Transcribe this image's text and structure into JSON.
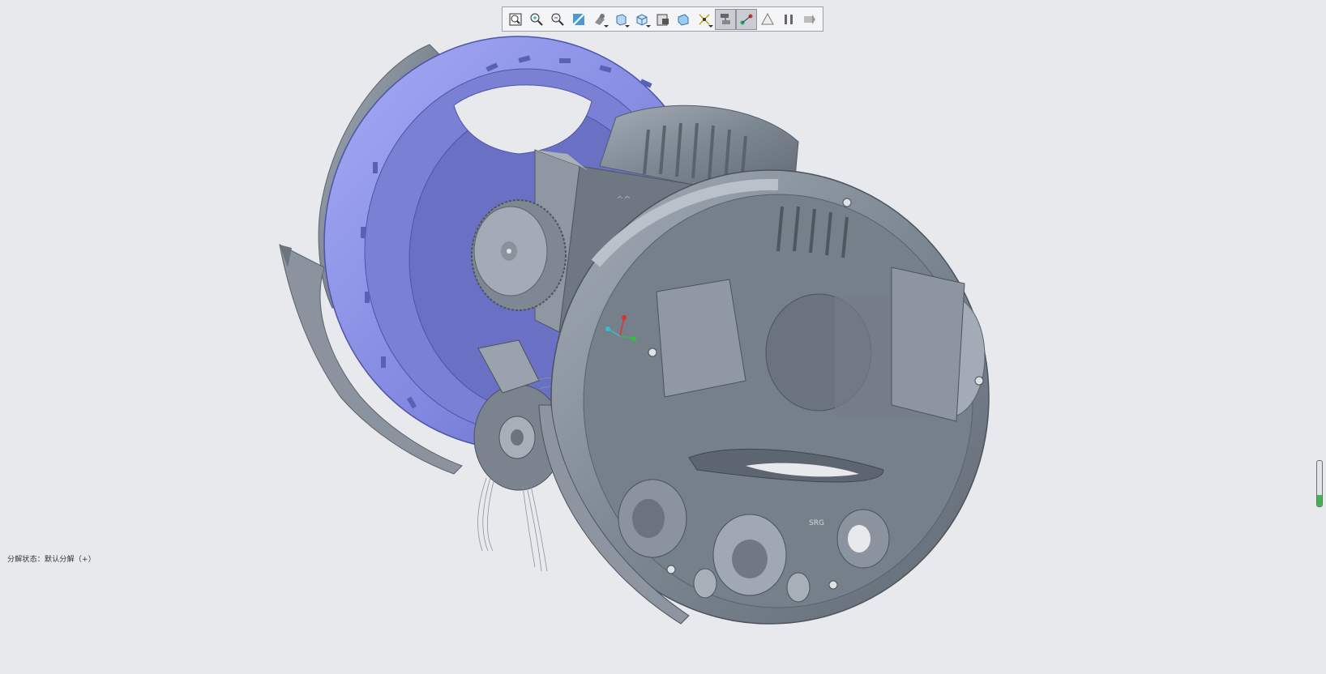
{
  "toolbar": {
    "buttons": [
      {
        "name": "zoom-fit-icon",
        "active": false
      },
      {
        "name": "zoom-in-icon",
        "active": false
      },
      {
        "name": "zoom-out-icon",
        "active": false
      },
      {
        "name": "repaint-icon",
        "active": false
      },
      {
        "name": "view-orientation-icon",
        "active": false,
        "menu": true
      },
      {
        "name": "display-style-icon",
        "active": false,
        "menu": true
      },
      {
        "name": "saved-views-icon",
        "active": false,
        "menu": true
      },
      {
        "name": "view-manager-icon",
        "active": false
      },
      {
        "name": "perspective-icon",
        "active": false
      },
      {
        "name": "datum-display-icon",
        "active": false,
        "menu": true
      },
      {
        "name": "explode-view-icon",
        "active": true
      },
      {
        "name": "edit-position-icon",
        "active": true
      },
      {
        "name": "annotation-icon",
        "active": false
      },
      {
        "name": "pause-icon",
        "active": false
      },
      {
        "name": "next-step-icon",
        "active": false
      }
    ]
  },
  "status": {
    "text": "分解状态：默认分解（+）"
  },
  "scroll_indicator": {
    "fill_fraction": 0.25
  },
  "colors": {
    "background": "#e8e9ec",
    "model_gray": "#7d8792",
    "model_highlight": "#8e95e8",
    "axis_x": "#e03030",
    "axis_y": "#30c040",
    "axis_z": "#30c0d0"
  }
}
